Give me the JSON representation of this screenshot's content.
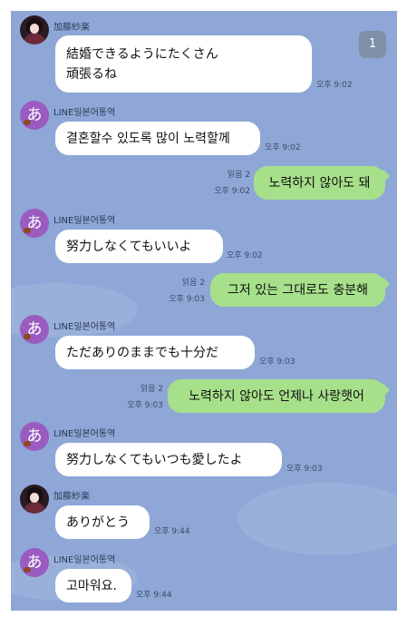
{
  "badge": "1",
  "messages": [
    {
      "sender": "加藤紗楽",
      "avatar": "photo",
      "direction": "in",
      "lines": [
        "結婚できるようにたくさん",
        "頑張るね"
      ],
      "time": "오후 9:02"
    },
    {
      "sender": "LINE일본어통역",
      "avatar": "あ",
      "direction": "in",
      "text": "결혼할수 있도록 많이 노력할께",
      "time": "오후 9:02"
    },
    {
      "direction": "out",
      "read": "읽음 2",
      "time": "오후 9:02",
      "text": "노력하지 않아도 돼"
    },
    {
      "sender": "LINE일본어통역",
      "avatar": "あ",
      "direction": "in",
      "text": "努力しなくてもいいよ",
      "time": "오후 9:02"
    },
    {
      "direction": "out",
      "read": "읽음 2",
      "time": "오후 9:03",
      "text": "그저 있는 그대로도 충분해"
    },
    {
      "sender": "LINE일본어통역",
      "avatar": "あ",
      "direction": "in",
      "text": "ただありのままでも十分だ",
      "time": "오후 9:03"
    },
    {
      "direction": "out",
      "read": "읽음 2",
      "time": "오후 9:03",
      "text": "노력하지 않아도 언제나 사랑햇어"
    },
    {
      "sender": "LINE일본어통역",
      "avatar": "あ",
      "direction": "in",
      "text": "努力しなくてもいつも愛したよ",
      "time": "오후 9:03"
    },
    {
      "sender": "加藤紗楽",
      "avatar": "photo",
      "direction": "in",
      "text": "ありがとう",
      "time": "오후 9:44"
    },
    {
      "sender": "LINE일본어통역",
      "avatar": "あ",
      "direction": "in",
      "text": "고마워요.",
      "time": "오후 9:44"
    }
  ],
  "colors": {
    "background": "#8ea7d6",
    "incoming_bubble": "#ffffff",
    "outgoing_bubble": "#a6e08a",
    "badge": "#7f91a8"
  }
}
